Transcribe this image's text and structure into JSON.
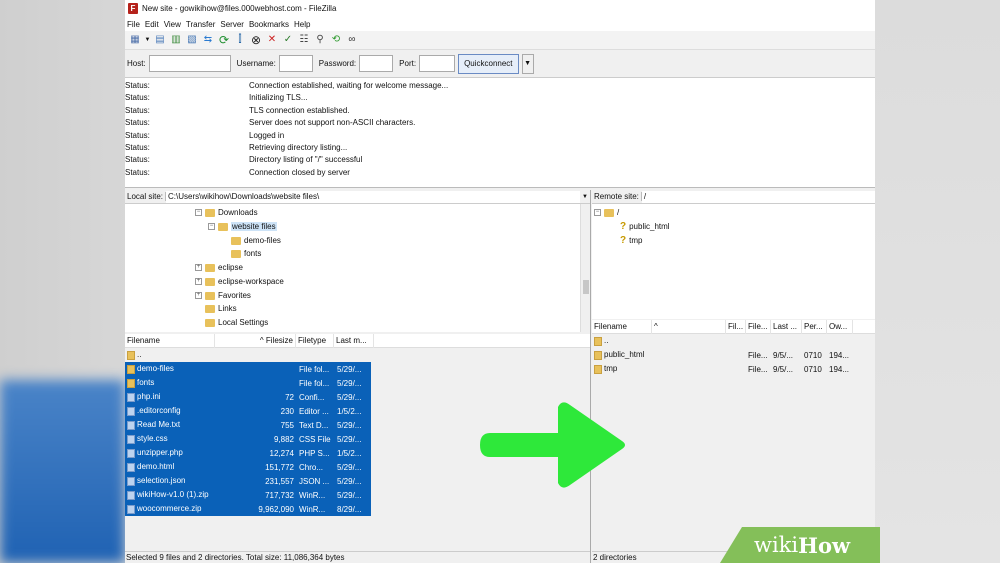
{
  "window": {
    "app_icon": "F",
    "title": "New site - gowikihow@files.000webhost.com - FileZilla"
  },
  "menu": [
    "File",
    "Edit",
    "View",
    "Transfer",
    "Server",
    "Bookmarks",
    "Help"
  ],
  "toolbar_icons": [
    "site-manager-icon",
    "dropdown-icon",
    "toggle-log-icon",
    "toggle-local-tree-icon",
    "toggle-remote-tree-icon",
    "toggle-queue-icon",
    "refresh-icon",
    "process-queue-icon",
    "cancel-icon",
    "disconnect-icon",
    "reconnect-icon",
    "directory-filter-icon",
    "compare-icon",
    "sync-browse-icon",
    "search-icon",
    "binoculars-icon"
  ],
  "quickconnect": {
    "host_label": "Host:",
    "host_value": "",
    "user_label": "Username:",
    "user_value": "",
    "pass_label": "Password:",
    "pass_value": "",
    "port_label": "Port:",
    "port_value": "",
    "button": "Quickconnect"
  },
  "log": [
    {
      "k": "Status:",
      "v": "Connection established, waiting for welcome message..."
    },
    {
      "k": "Status:",
      "v": "Initializing TLS..."
    },
    {
      "k": "Status:",
      "v": "TLS connection established."
    },
    {
      "k": "Status:",
      "v": "Server does not support non-ASCII characters."
    },
    {
      "k": "Status:",
      "v": "Logged in"
    },
    {
      "k": "Status:",
      "v": "Retrieving directory listing..."
    },
    {
      "k": "Status:",
      "v": "Directory listing of \"/\" successful"
    },
    {
      "k": "Status:",
      "v": "Connection closed by server"
    }
  ],
  "local": {
    "site_label": "Local site:",
    "path": "C:\\Users\\wikihow\\Downloads\\website files\\",
    "tree": [
      {
        "label": "Downloads",
        "exp": "⊟"
      },
      {
        "label": "website files",
        "exp": "⊟"
      },
      {
        "label": "demo-files",
        "exp": ""
      },
      {
        "label": "fonts",
        "exp": ""
      },
      {
        "label": "eclipse",
        "exp": "⊞"
      },
      {
        "label": "eclipse-workspace",
        "exp": "⊞"
      },
      {
        "label": "Favorites",
        "exp": "⊞"
      },
      {
        "label": "Links",
        "exp": ""
      },
      {
        "label": "Local Settings",
        "exp": ""
      }
    ],
    "columns": [
      "Filename",
      "^ Filesize",
      "Filetype",
      "Last m..."
    ],
    "files": [
      {
        "name": "..",
        "size": "",
        "type": "",
        "mod": "",
        "sel": false,
        "dir": true
      },
      {
        "name": "demo-files",
        "size": "",
        "type": "File fol...",
        "mod": "5/29/...",
        "sel": true,
        "dir": true
      },
      {
        "name": "fonts",
        "size": "",
        "type": "File fol...",
        "mod": "5/29/...",
        "sel": true,
        "dir": true
      },
      {
        "name": "php.ini",
        "size": "72",
        "type": "Confi...",
        "mod": "5/29/...",
        "sel": true,
        "dir": false
      },
      {
        "name": ".editorconfig",
        "size": "230",
        "type": "Editor ...",
        "mod": "1/5/2...",
        "sel": true,
        "dir": false
      },
      {
        "name": "Read Me.txt",
        "size": "755",
        "type": "Text D...",
        "mod": "5/29/...",
        "sel": true,
        "dir": false
      },
      {
        "name": "style.css",
        "size": "9,882",
        "type": "CSS File",
        "mod": "5/29/...",
        "sel": true,
        "dir": false
      },
      {
        "name": "unzipper.php",
        "size": "12,274",
        "type": "PHP S...",
        "mod": "1/5/2...",
        "sel": true,
        "dir": false
      },
      {
        "name": "demo.html",
        "size": "151,772",
        "type": "Chro...",
        "mod": "5/29/...",
        "sel": true,
        "dir": false
      },
      {
        "name": "selection.json",
        "size": "231,557",
        "type": "JSON ...",
        "mod": "5/29/...",
        "sel": true,
        "dir": false
      },
      {
        "name": "wikiHow-v1.0 (1).zip",
        "size": "717,732",
        "type": "WinR...",
        "mod": "5/29/...",
        "sel": true,
        "dir": false
      },
      {
        "name": "woocommerce.zip",
        "size": "9,962,090",
        "type": "WinR...",
        "mod": "8/29/...",
        "sel": true,
        "dir": false
      }
    ],
    "status": "Selected 9 files and 2 directories. Total size: 11,086,364 bytes"
  },
  "remote": {
    "site_label": "Remote site:",
    "path": "/",
    "tree": [
      {
        "label": "/",
        "exp": "⊟"
      },
      {
        "label": "public_html",
        "exp": ""
      },
      {
        "label": "tmp",
        "exp": ""
      }
    ],
    "columns": [
      "Filename",
      "^",
      "Fil...",
      "File...",
      "Last ...",
      "Per...",
      "Ow..."
    ],
    "files": [
      {
        "name": "..",
        "size": "",
        "type": "",
        "mod": "",
        "perm": "",
        "owner": ""
      },
      {
        "name": "public_html",
        "size": "",
        "type": "File...",
        "mod": "9/5/...",
        "perm": "0710",
        "owner": "194..."
      },
      {
        "name": "tmp",
        "size": "",
        "type": "File...",
        "mod": "9/5/...",
        "perm": "0710",
        "owner": "194..."
      }
    ],
    "status": "2 directories"
  },
  "colors": {
    "selection": "#0a61b8",
    "arrow": "#2ee83a",
    "wikihow_green": "#84bf59"
  },
  "watermark": {
    "wiki": "wiki",
    "how": "How"
  }
}
